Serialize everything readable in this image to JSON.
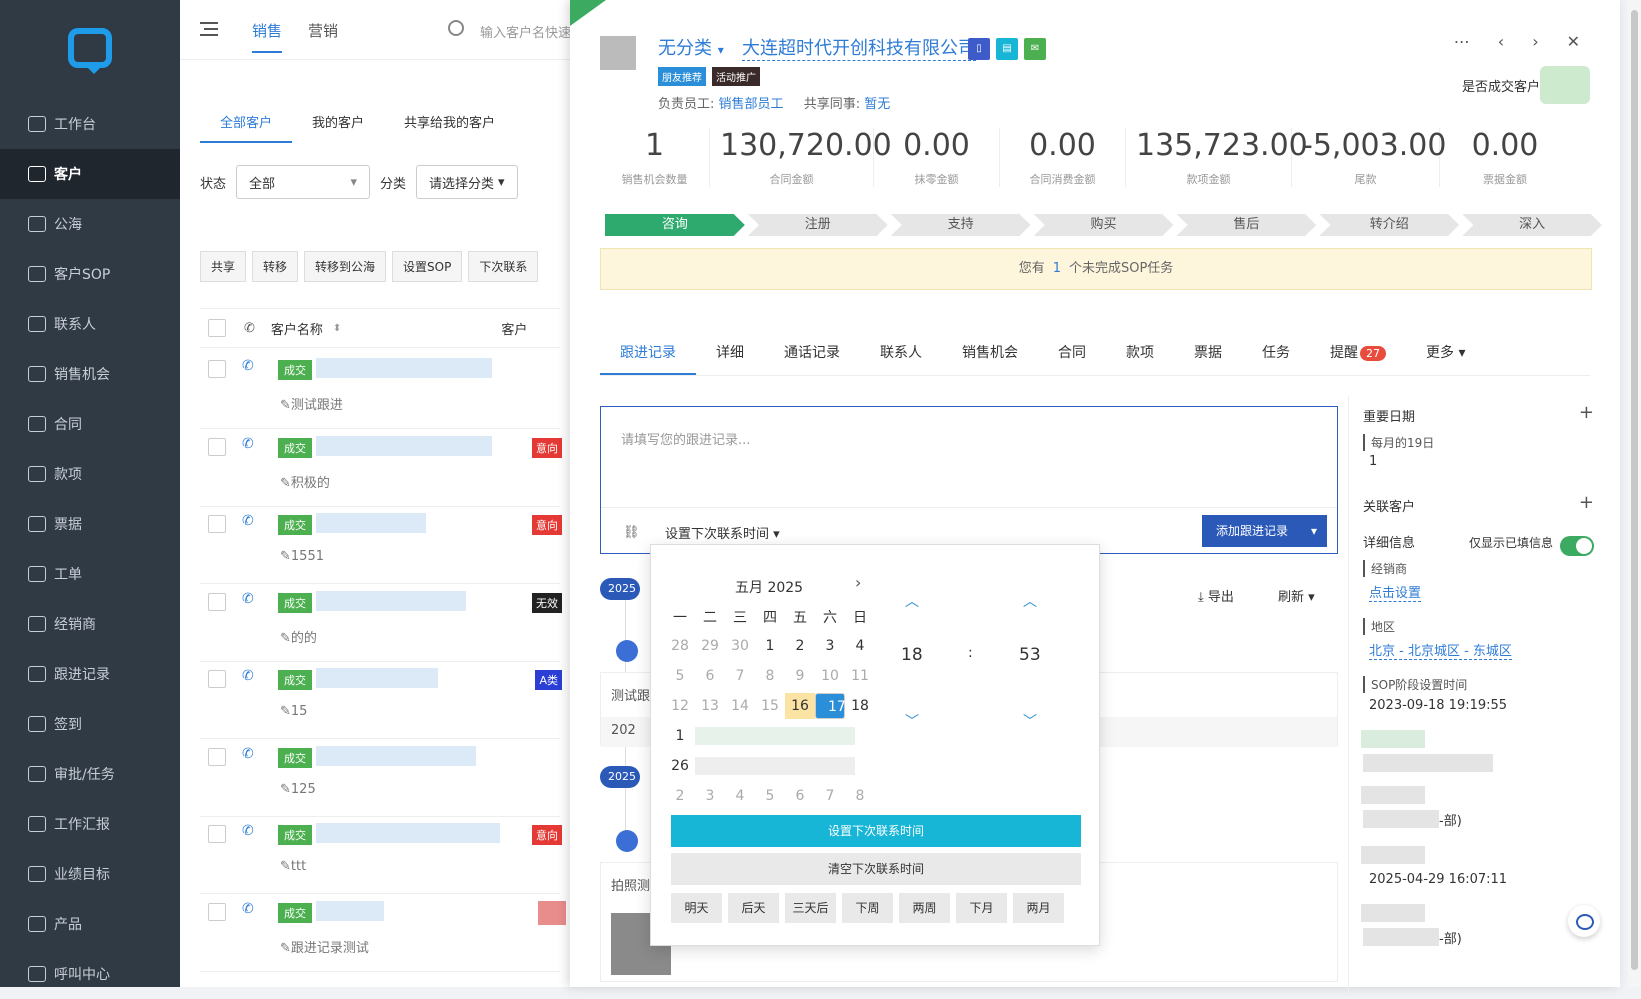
{
  "sidebar": {
    "items": [
      {
        "label": "工作台",
        "icon": "desktop-icon"
      },
      {
        "label": "客户",
        "icon": "customer-icon"
      },
      {
        "label": "公海",
        "icon": "sea-icon"
      },
      {
        "label": "客户SOP",
        "icon": "sop-icon"
      },
      {
        "label": "联系人",
        "icon": "contact-icon"
      },
      {
        "label": "销售机会",
        "icon": "opportunity-icon"
      },
      {
        "label": "合同",
        "icon": "contract-icon"
      },
      {
        "label": "款项",
        "icon": "payment-icon"
      },
      {
        "label": "票据",
        "icon": "invoice-icon"
      },
      {
        "label": "工单",
        "icon": "ticket-icon"
      },
      {
        "label": "经销商",
        "icon": "dealer-icon"
      },
      {
        "label": "跟进记录",
        "icon": "followup-icon"
      },
      {
        "label": "签到",
        "icon": "checkin-icon"
      },
      {
        "label": "审批/任务",
        "icon": "approval-icon"
      },
      {
        "label": "工作汇报",
        "icon": "report-icon"
      },
      {
        "label": "业绩目标",
        "icon": "target-icon"
      },
      {
        "label": "产品",
        "icon": "product-icon"
      },
      {
        "label": "呼叫中心",
        "icon": "call-center-icon"
      }
    ]
  },
  "topbar": {
    "tabs": [
      "销售",
      "营销"
    ],
    "search_placeholder": "输入客户名快速"
  },
  "list": {
    "subtabs": [
      "全部客户",
      "我的客户",
      "共享给我的客户"
    ],
    "filter_status_label": "状态",
    "filter_status_value": "全部",
    "filter_cat_label": "分类",
    "filter_cat_value": "请选择分类",
    "actions": [
      "共享",
      "转移",
      "转移到公海",
      "设置SOP",
      "下次联系"
    ],
    "col_name": "客户名称",
    "col_other": "客户",
    "rows": [
      {
        "tag": "成交",
        "note": "测试跟进",
        "badge": ""
      },
      {
        "tag": "成交",
        "note": "积极的",
        "badge": "意向"
      },
      {
        "tag": "成交",
        "note": "1551",
        "badge": "意向"
      },
      {
        "tag": "成交",
        "note": "的的",
        "badge": "无效"
      },
      {
        "tag": "成交",
        "note": "15",
        "badge": "A类"
      },
      {
        "tag": "成交",
        "note": "125",
        "badge": ""
      },
      {
        "tag": "成交",
        "note": "ttt",
        "badge": "意向"
      },
      {
        "tag": "成交",
        "note": "跟进记录测试",
        "badge": ""
      }
    ]
  },
  "detail": {
    "category": "无分类",
    "company": "大连超时代开创科技有限公司",
    "tags": [
      "朋友推荐",
      "活动推广"
    ],
    "owner_label": "负责员工:",
    "owner": "销售部员工",
    "share_label": "共享同事:",
    "share": "暂无",
    "deal_label": "是否成交客户",
    "stats": [
      {
        "value": "1",
        "label": "销售机会数量"
      },
      {
        "value": "130,720.00",
        "label": "合同金额"
      },
      {
        "value": "0.00",
        "label": "抹零金额"
      },
      {
        "value": "0.00",
        "label": "合同消费金额"
      },
      {
        "value": "135,723.00",
        "label": "款项金额"
      },
      {
        "value": "-5,003.00",
        "label": "尾款"
      },
      {
        "value": "0.00",
        "label": "票据金额"
      }
    ],
    "stages": [
      "咨询",
      "注册",
      "支持",
      "购买",
      "售后",
      "转介绍",
      "深入"
    ],
    "sop_prefix": "您有",
    "sop_count": "1",
    "sop_suffix": "个未完成SOP任务",
    "tabs": [
      "跟进记录",
      "详细",
      "通话记录",
      "联系人",
      "销售机会",
      "合同",
      "款项",
      "票据",
      "任务",
      "提醒",
      "更多"
    ],
    "reminder_count": "27",
    "editor_placeholder": "请填写您的跟进记录...",
    "next_contact": "设置下次联系时间",
    "add_button": "添加跟进记录",
    "timeline_chip": "2025",
    "export": "导出",
    "refresh": "刷新",
    "card1_text": "测试跟",
    "card1_date": "202",
    "card2_text": "拍照测"
  },
  "right": {
    "important_dates": "重要日期",
    "monthly": "每月的19日",
    "monthly_val": "1",
    "related": "关联客户",
    "details": "详细信息",
    "only_filled": "仅显示已填信息",
    "dealer_label": "经销商",
    "dealer_link": "点击设置",
    "region_label": "地区",
    "region_link": "北京 - 北京城区 - 东城区",
    "sop_time_label": "SOP阶段设置时间",
    "sop_time": "2023-09-18 19:19:55",
    "dept1": "-部)",
    "time2": "2025-04-29 16:07:11",
    "dept2": "-部)"
  },
  "picker": {
    "title": "五月 2025",
    "weekdays": [
      "一",
      "二",
      "三",
      "四",
      "五",
      "六",
      "日"
    ],
    "row1": [
      "28",
      "29",
      "30",
      "1",
      "2",
      "3",
      "4"
    ],
    "row2": [
      "5",
      "6",
      "7",
      "8",
      "9",
      "10",
      "11"
    ],
    "row3": [
      "12",
      "13",
      "14",
      "15",
      "16",
      "17",
      "18"
    ],
    "row4_first": "1",
    "row5_first": "26",
    "row6": [
      "2",
      "3",
      "4",
      "5",
      "6",
      "7",
      "8"
    ],
    "hour": "18",
    "colon": ":",
    "minute": "53",
    "set_btn": "设置下次联系时间",
    "clear_btn": "清空下次联系时间",
    "quick": [
      "明天",
      "后天",
      "三天后",
      "下周",
      "两周",
      "下月",
      "两月"
    ]
  }
}
